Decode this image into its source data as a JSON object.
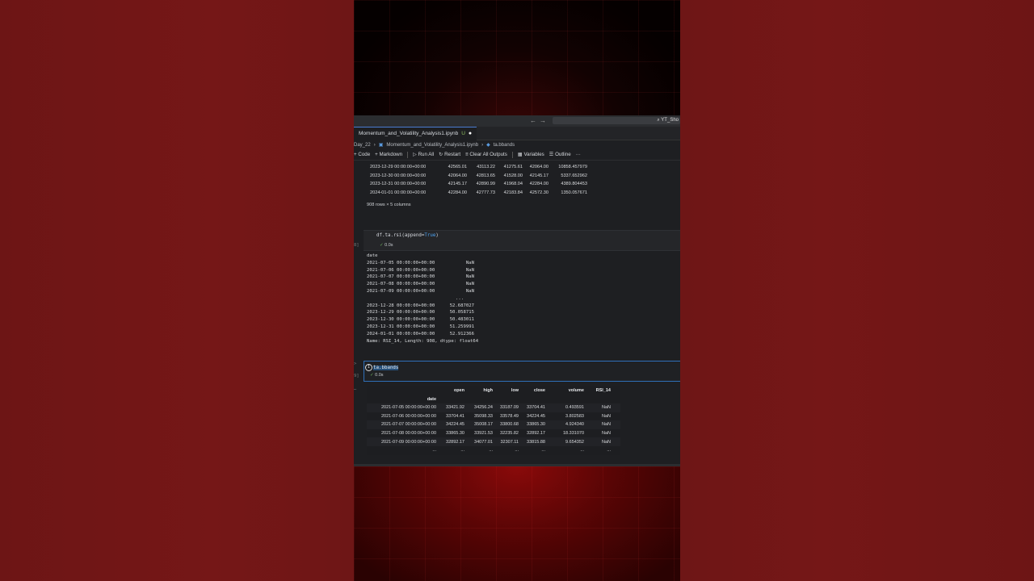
{
  "window": {
    "search_text": "⌕ YT_Sho",
    "tab_label": "Momentum_and_Volatility_Analysis1.ipynb",
    "tab_status": "U"
  },
  "breadcrumb": {
    "part1": "Day_22",
    "part2": "Momentum_and_Volatility_Analysis1.ipynb",
    "part3": "ta.bbands"
  },
  "toolbar": {
    "code": "Code",
    "markdown": "Markdown",
    "run_all": "Run All",
    "restart": "Restart",
    "clear_all": "Clear All Outputs",
    "variables": "Variables",
    "outline": "Outline",
    "more": "···"
  },
  "output1": {
    "rows": [
      [
        "2023-12-29 00:00:00+00:00",
        "42565.01",
        "43113.22",
        "41275.61",
        "42064.00",
        "10858.457979"
      ],
      [
        "2023-12-30 00:00:00+00:00",
        "42064.00",
        "42813.65",
        "41528.00",
        "42145.17",
        "5337.652962"
      ],
      [
        "2023-12-31 00:00:00+00:00",
        "42145.17",
        "42890.99",
        "41968.04",
        "42284.00",
        "4389.804453"
      ],
      [
        "2024-01-01 00:00:00+00:00",
        "42284.00",
        "42777.73",
        "42183.84",
        "42572.30",
        "1350.057671"
      ]
    ],
    "shape": "908 rows × 5 columns"
  },
  "cell2": {
    "code_prefix": "df.ta.rsi(append=",
    "code_kw": "True",
    "code_suffix": ")",
    "gutter": "8]",
    "exec_time": "0.0s"
  },
  "series_out": {
    "index_name": "date",
    "rows_head": [
      [
        "2021-07-05 00:00:00+00:00",
        "NaN"
      ],
      [
        "2021-07-06 00:00:00+00:00",
        "NaN"
      ],
      [
        "2021-07-07 00:00:00+00:00",
        "NaN"
      ],
      [
        "2021-07-08 00:00:00+00:00",
        "NaN"
      ],
      [
        "2021-07-09 00:00:00+00:00",
        "NaN"
      ]
    ],
    "ellipsis": "...",
    "rows_tail": [
      [
        "2023-12-28 00:00:00+00:00",
        "52.687027"
      ],
      [
        "2023-12-29 00:00:00+00:00",
        "50.058715"
      ],
      [
        "2023-12-30 00:00:00+00:00",
        "50.483011"
      ],
      [
        "2023-12-31 00:00:00+00:00",
        "51.259991"
      ],
      [
        "2024-01-01 00:00:00+00:00",
        "52.912366"
      ]
    ],
    "footer": "Name: RSI_14, Length: 908, dtype: float64"
  },
  "cell3": {
    "code": "ta.bbands",
    "gutter_top": ">",
    "gutter": "9]",
    "exec_time": "0.0s"
  },
  "output3": {
    "columns": [
      "open",
      "high",
      "low",
      "close",
      "volume",
      "RSI_14"
    ],
    "index_name": "date",
    "rows": [
      [
        "2021-07-05 00:00:00+00:00",
        "33421.92",
        "34256.24",
        "33187.09",
        "33704.41",
        "0.493591",
        "NaN"
      ],
      [
        "2021-07-06 00:00:00+00:00",
        "33704.41",
        "35098.33",
        "33578.49",
        "34224.45",
        "3.802583",
        "NaN"
      ],
      [
        "2021-07-07 00:00:00+00:00",
        "34224.45",
        "35008.17",
        "33800.68",
        "33865.30",
        "4.924340",
        "NaN"
      ],
      [
        "2021-07-08 00:00:00+00:00",
        "33865.30",
        "33921.53",
        "32235.82",
        "32892.17",
        "18.331070",
        "NaN"
      ],
      [
        "2021-07-09 00:00:00+00:00",
        "32892.17",
        "34077.01",
        "32307.11",
        "33815.88",
        "9.654352",
        "NaN"
      ],
      [
        "...",
        "...",
        "...",
        "...",
        "...",
        "...",
        "..."
      ]
    ]
  }
}
